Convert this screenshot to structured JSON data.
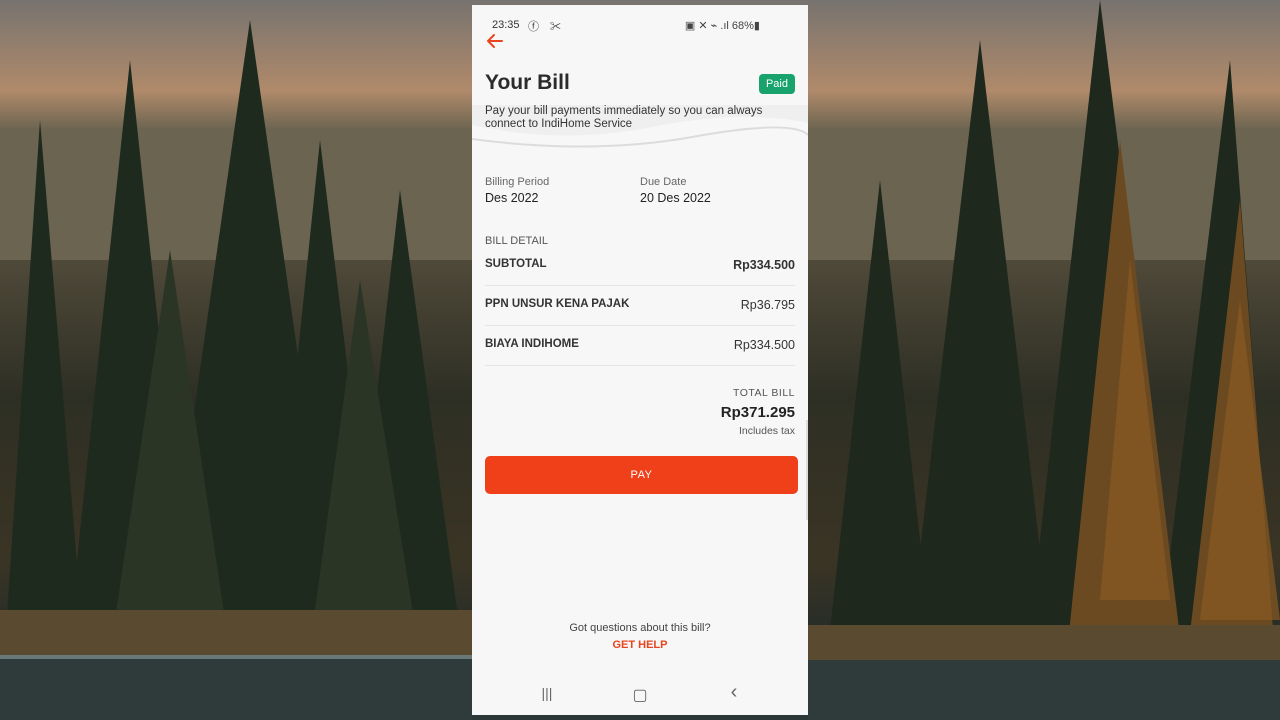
{
  "status_bar": {
    "time": "23:35",
    "left_icons": "ⓕ ✂",
    "right_text": "▣ ✕ ⌁ .ıl 68%▮",
    "battery_percent": 68
  },
  "header": {
    "title": "Your Bill",
    "status_badge": "Paid",
    "subtitle": "Pay your bill payments immediately so you can always connect to IndiHome Service",
    "back_icon": "arrow-left-icon"
  },
  "billing": {
    "period_label": "Billing Period",
    "period_value": "Des 2022",
    "due_label": "Due Date",
    "due_value": "20 Des 2022"
  },
  "bill_detail": {
    "heading": "BILL DETAIL",
    "rows": [
      {
        "label": "SUBTOTAL",
        "value": "Rp334.500"
      },
      {
        "label": "PPN UNSUR KENA PAJAK",
        "value": "Rp36.795"
      },
      {
        "label": "BIAYA INDIHOME",
        "value": "Rp334.500"
      }
    ]
  },
  "total": {
    "label": "TOTAL BILL",
    "value": "Rp371.295",
    "note": "Includes tax"
  },
  "pay_button": "PAY",
  "help": {
    "question": "Got questions about this bill?",
    "link": "GET HELP"
  },
  "nav": {
    "recent": "|||",
    "home": "▢",
    "back": "‹"
  },
  "colors": {
    "accent": "#f0401a",
    "paid_badge": "#17a36b"
  }
}
